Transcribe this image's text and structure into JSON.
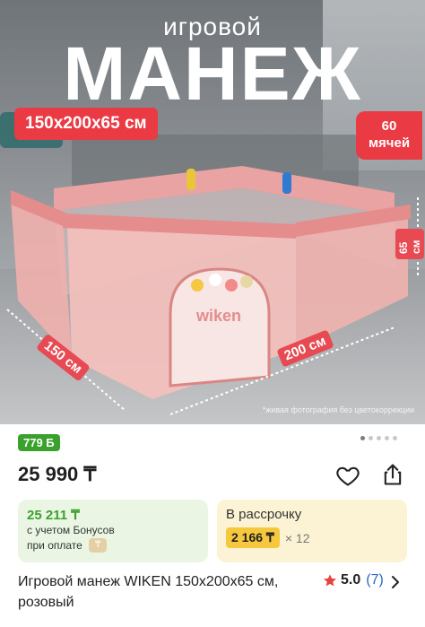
{
  "hero": {
    "subtitle": "игровой",
    "title": "МАНЕЖ",
    "dimensions_badge": "150х200х65 см",
    "balls_badge_line1": "60",
    "balls_badge_line2": "мячей",
    "label_width": "150 см",
    "label_length": "200 см",
    "label_height": "65 см",
    "brand_on_product": "wiken",
    "photo_note": "*живая фотография без цветокоррекции"
  },
  "gallery": {
    "total_pages": 5,
    "active_index": 0
  },
  "product": {
    "bonus_badge": "779 Б",
    "price": "25 990 ₸",
    "title": "Игровой манеж WIKEN 150x200x65 см, розовый",
    "rating_value": "5.0",
    "rating_count": "(7)"
  },
  "bonus_card": {
    "amount": "25 211 ₸",
    "line1": "с учетом Бонусов",
    "line2": "при оплате"
  },
  "installment_card": {
    "label": "В рассрочку",
    "amount": "2 166 ₸",
    "multiplier": "× 12"
  },
  "icons": {
    "favorite": "heart-icon",
    "share": "share-icon",
    "rating": "star-icon",
    "more": "chevron-right-icon",
    "payment": "wallet-icon"
  },
  "colors": {
    "accent_red": "#ea3a44",
    "bonus_green": "#3aa12c",
    "installment_yellow": "#f6c83e",
    "rating_star": "#e8403c",
    "link_blue": "#2b67c8"
  }
}
